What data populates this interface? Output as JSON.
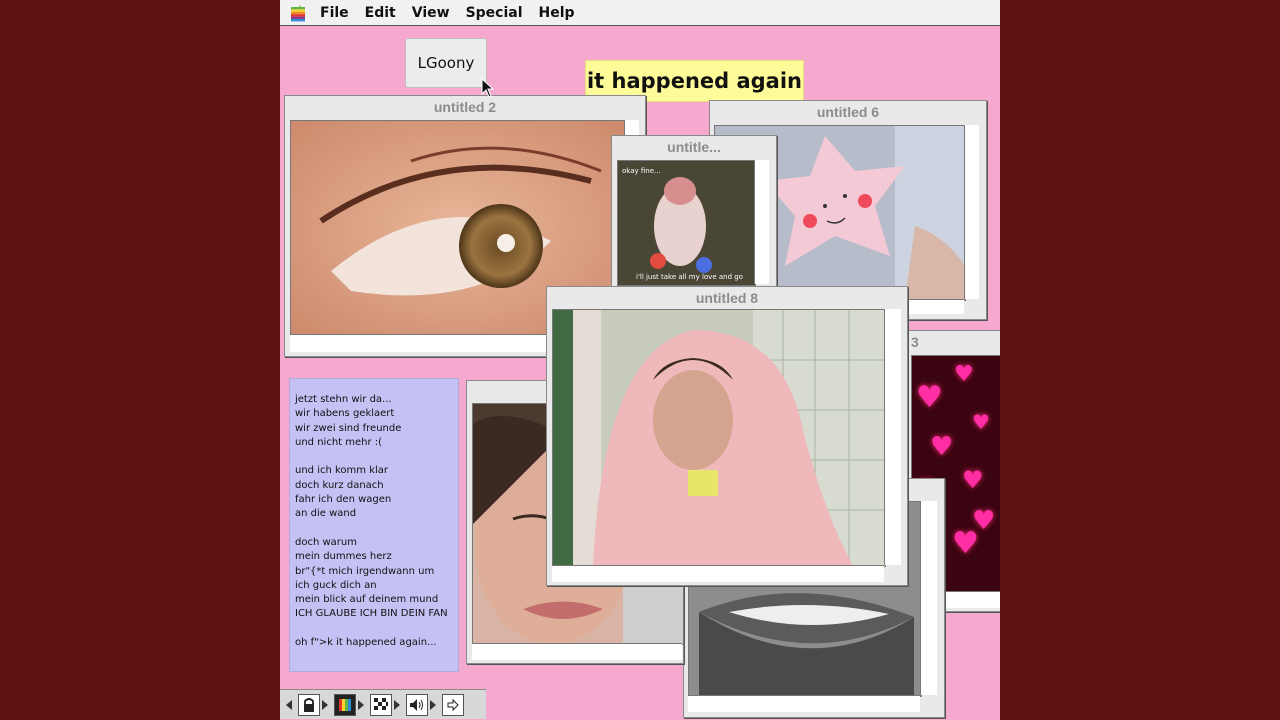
{
  "menubar": {
    "menus": [
      "File",
      "Edit",
      "View",
      "Special",
      "Help"
    ]
  },
  "desktop_button": {
    "label": "LGoony"
  },
  "banner": {
    "text": "it happened again"
  },
  "windows": {
    "w2": {
      "title": "untitled 2"
    },
    "w6": {
      "title": "untitled 6"
    },
    "wsmall": {
      "title": "untitle...",
      "caption_top": "okay fine...",
      "caption_bottom": "i'll just take all my love and go"
    },
    "w8": {
      "title": "untitled 8"
    },
    "w3": {
      "title": "3"
    }
  },
  "lyrics": [
    "jetzt stehn wir da...",
    "wir habens geklaert",
    "wir zwei sind freunde",
    "und nicht mehr :(",
    "",
    "und ich komm klar",
    "doch kurz danach",
    "fahr ich den wagen",
    "an die wand",
    "",
    "doch warum",
    "mein dummes herz",
    "br\"{*t mich irgendwann um",
    "ich guck dich an",
    "mein blick auf deinem mund",
    "ICH GLAUBE ICH BIN DEIN FAN",
    "",
    "oh f\">k it happened again..."
  ],
  "control_strip": {
    "items": [
      "lock-icon",
      "monitor-color-icon",
      "pattern-icon",
      "speaker-icon",
      "arrow-icon"
    ]
  },
  "colors": {
    "frame": "#5e1212",
    "desktop": "#f6a9cf",
    "banner": "#fdfc99",
    "lyrics_panel": "#c6c1f4"
  }
}
